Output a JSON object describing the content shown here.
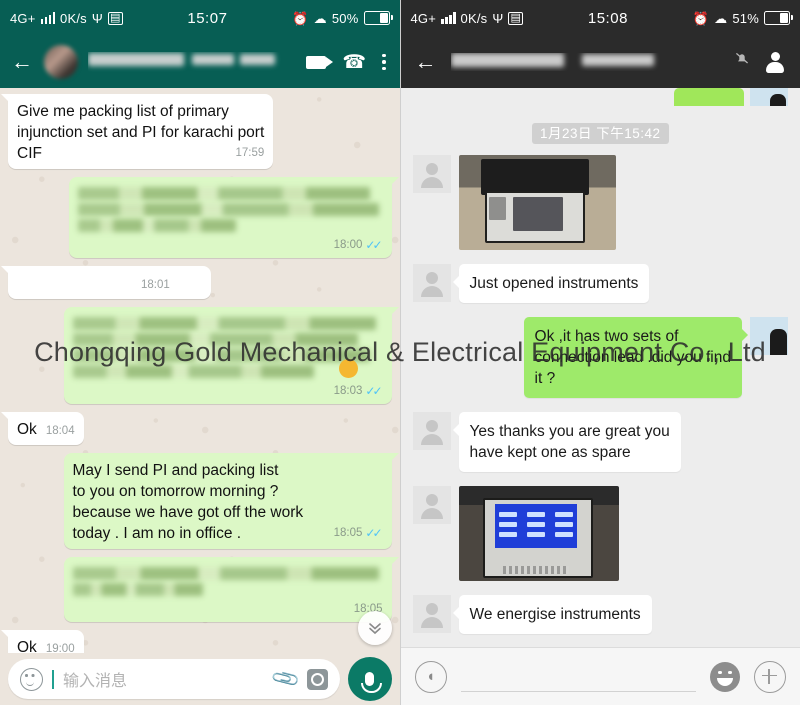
{
  "watermark": "Chongqing Gold Mechanical & Electrical Equipment Co., Ltd",
  "whatsapp": {
    "statusbar": {
      "network": "4G+",
      "speed": "0K/s",
      "time": "15:07",
      "battery_percent": "50%",
      "icons": [
        "signal-bars-icon",
        "usb-icon",
        "sim-icon",
        "alarm-icon",
        "wifi-icon",
        "battery-icon"
      ]
    },
    "header": {
      "back": "←",
      "contact_name": "",
      "video_call": "video-call-icon",
      "voice_call": "phone-icon",
      "menu": "overflow-menu-icon"
    },
    "messages": [
      {
        "dir": "in",
        "text": "Give me packing list of primary\ninjunction set and PI for karachi port\nCIF",
        "time": "17:59",
        "blurred": false,
        "ticks": false
      },
      {
        "dir": "out",
        "text": "",
        "time": "18:00",
        "blurred": true,
        "lines": 3,
        "ticks": true
      },
      {
        "dir": "in",
        "text": "",
        "time": "18:01",
        "blurred": true,
        "lines": 1,
        "ticks": false
      },
      {
        "dir": "out",
        "text": "",
        "time": "18:03",
        "blurred": true,
        "lines": 4,
        "ticks": true,
        "emoji": true
      },
      {
        "dir": "in",
        "text": "Ok",
        "time": "18:04",
        "blurred": false,
        "ticks": false
      },
      {
        "dir": "out",
        "text": "May I send PI and packing list\nto you on tomorrow morning ?\nbecause we have got off the work\ntoday . I am no in office .",
        "time": "18:05",
        "blurred": false,
        "ticks": true
      },
      {
        "dir": "out",
        "text": "",
        "time": "18:05",
        "blurred": true,
        "lines": 2,
        "ticks": false
      },
      {
        "dir": "in",
        "text": "Ok",
        "time": "19:00",
        "blurred": false,
        "ticks": false
      }
    ],
    "scroll_button": "»",
    "input": {
      "placeholder": "输入消息",
      "emoji": "emoji-icon",
      "attach": "📎",
      "camera": "camera-icon",
      "mic": "mic-icon"
    },
    "colors": {
      "header": "#075e54",
      "out_bubble": "#dcf8c6",
      "in_bubble": "#ffffff",
      "background": "#ece5dd",
      "ticks": "#4fc3f7"
    }
  },
  "wechat": {
    "statusbar": {
      "network": "4G+",
      "speed": "0K/s",
      "time": "15:08",
      "battery_percent": "51%"
    },
    "header": {
      "back": "←",
      "contact_name": "",
      "mute": "bell-muted-icon",
      "profile": "contact-profile-icon"
    },
    "date_divider": "1月23日 下午15:42",
    "messages": [
      {
        "dir": "in",
        "type": "image",
        "variant": "p1"
      },
      {
        "dir": "in",
        "type": "text",
        "text": "Just opened instruments"
      },
      {
        "dir": "out",
        "type": "text",
        "text": "Ok ,it has two sets of\nconnection lead .did you find\nit ?"
      },
      {
        "dir": "in",
        "type": "text",
        "text": "Yes thanks you are great you\nhave kept one as spare"
      },
      {
        "dir": "in",
        "type": "image",
        "variant": "p2"
      },
      {
        "dir": "in",
        "type": "text",
        "text": "We energise instruments"
      }
    ],
    "input": {
      "voice": "voice-input-icon",
      "value": "",
      "emoji": "emoji-icon",
      "more": "plus-icon"
    },
    "colors": {
      "header": "#2b2b2b",
      "out_bubble": "#9eea6a",
      "in_bubble": "#ffffff",
      "background": "#ededed"
    }
  }
}
